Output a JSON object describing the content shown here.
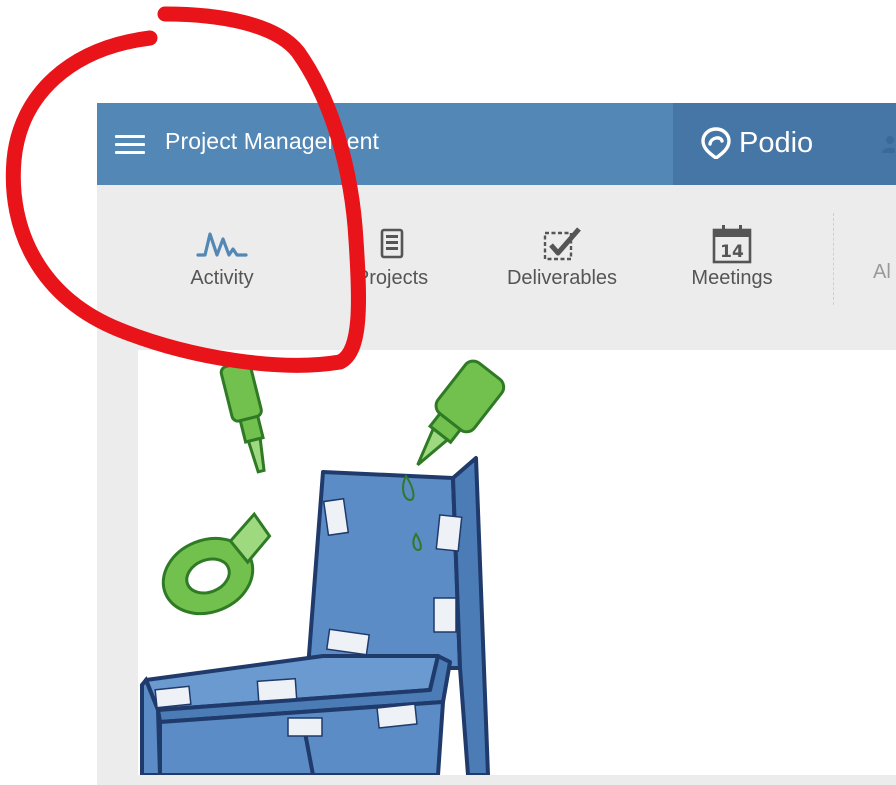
{
  "header": {
    "workspace_title": "Project Management",
    "brand_label": "Podio",
    "colors": {
      "bar": "#5387b5",
      "brand_zone": "#4576a5",
      "text": "#ffffff"
    }
  },
  "app_nav": {
    "items": [
      {
        "label": "Activity",
        "icon": "activity-pulse-icon",
        "icon_color": "#5387b5"
      },
      {
        "label": "Projects",
        "icon": "document-list-icon",
        "icon_color": "#555555"
      },
      {
        "label": "Deliverables",
        "icon": "checkbox-checked-icon",
        "icon_color": "#555555"
      },
      {
        "label": "Meetings",
        "icon": "calendar-icon",
        "icon_color": "#555555",
        "calendar_day": "14"
      }
    ],
    "partial_item_label": "Al"
  },
  "content": {
    "illustration": "chair-with-tape-and-glue-illustration",
    "colors": {
      "chair": "#5b8cc6",
      "tools": "#72c04e",
      "outline": "#1f3a6b"
    }
  },
  "annotation": {
    "shape": "hand-drawn-circle",
    "color": "#e8141a"
  }
}
